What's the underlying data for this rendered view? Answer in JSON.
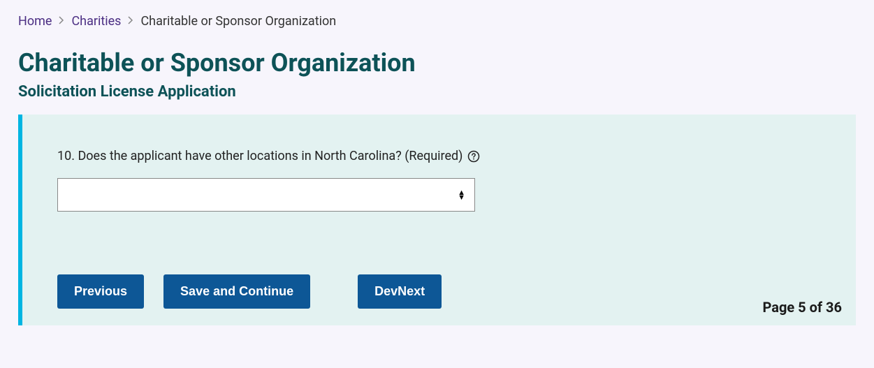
{
  "breadcrumb": {
    "home": "Home",
    "charities": "Charities",
    "current": "Charitable or Sponsor Organization"
  },
  "page": {
    "title": "Charitable or Sponsor Organization",
    "subtitle": "Solicitation License Application",
    "indicator": "Page 5 of 36"
  },
  "form": {
    "question": "10. Does the applicant have other locations in North Carolina? (Required)",
    "select_value": ""
  },
  "buttons": {
    "previous": "Previous",
    "save_continue": "Save and Continue",
    "devnext": "DevNext"
  }
}
